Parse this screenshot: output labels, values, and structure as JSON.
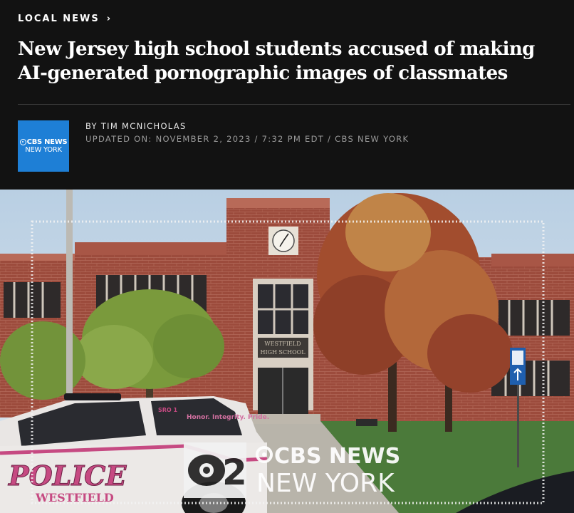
{
  "header": {
    "kicker": "LOCAL NEWS",
    "kicker_chevron": "›",
    "headline": "New Jersey high school students accused of making AI-generated pornographic images of classmates",
    "byline": "BY TIM MCNICHOLAS",
    "meta": "UPDATED ON: NOVEMBER 2, 2023 / 7:32 PM EDT / CBS NEW YORK"
  },
  "logo": {
    "line1": "CBS NEWS",
    "line2": "NEW YORK",
    "color": "#1e7fd6"
  },
  "photo": {
    "school_sign_line1": "WESTFIELD",
    "school_sign_line2": "HIGH SCHOOL",
    "car_text_police": "POLICE",
    "car_text_town": "WESTFIELD",
    "car_text_motto": "Honor. Integrity. Pride.",
    "car_badge": "SRO 1",
    "watermark_channel": "2",
    "watermark_line1": "CBS NEWS",
    "watermark_line2": "NEW YORK"
  },
  "icons": [
    "chevron-right-icon",
    "cbs-eye-icon",
    "clock-icon",
    "parking-sign-icon"
  ]
}
